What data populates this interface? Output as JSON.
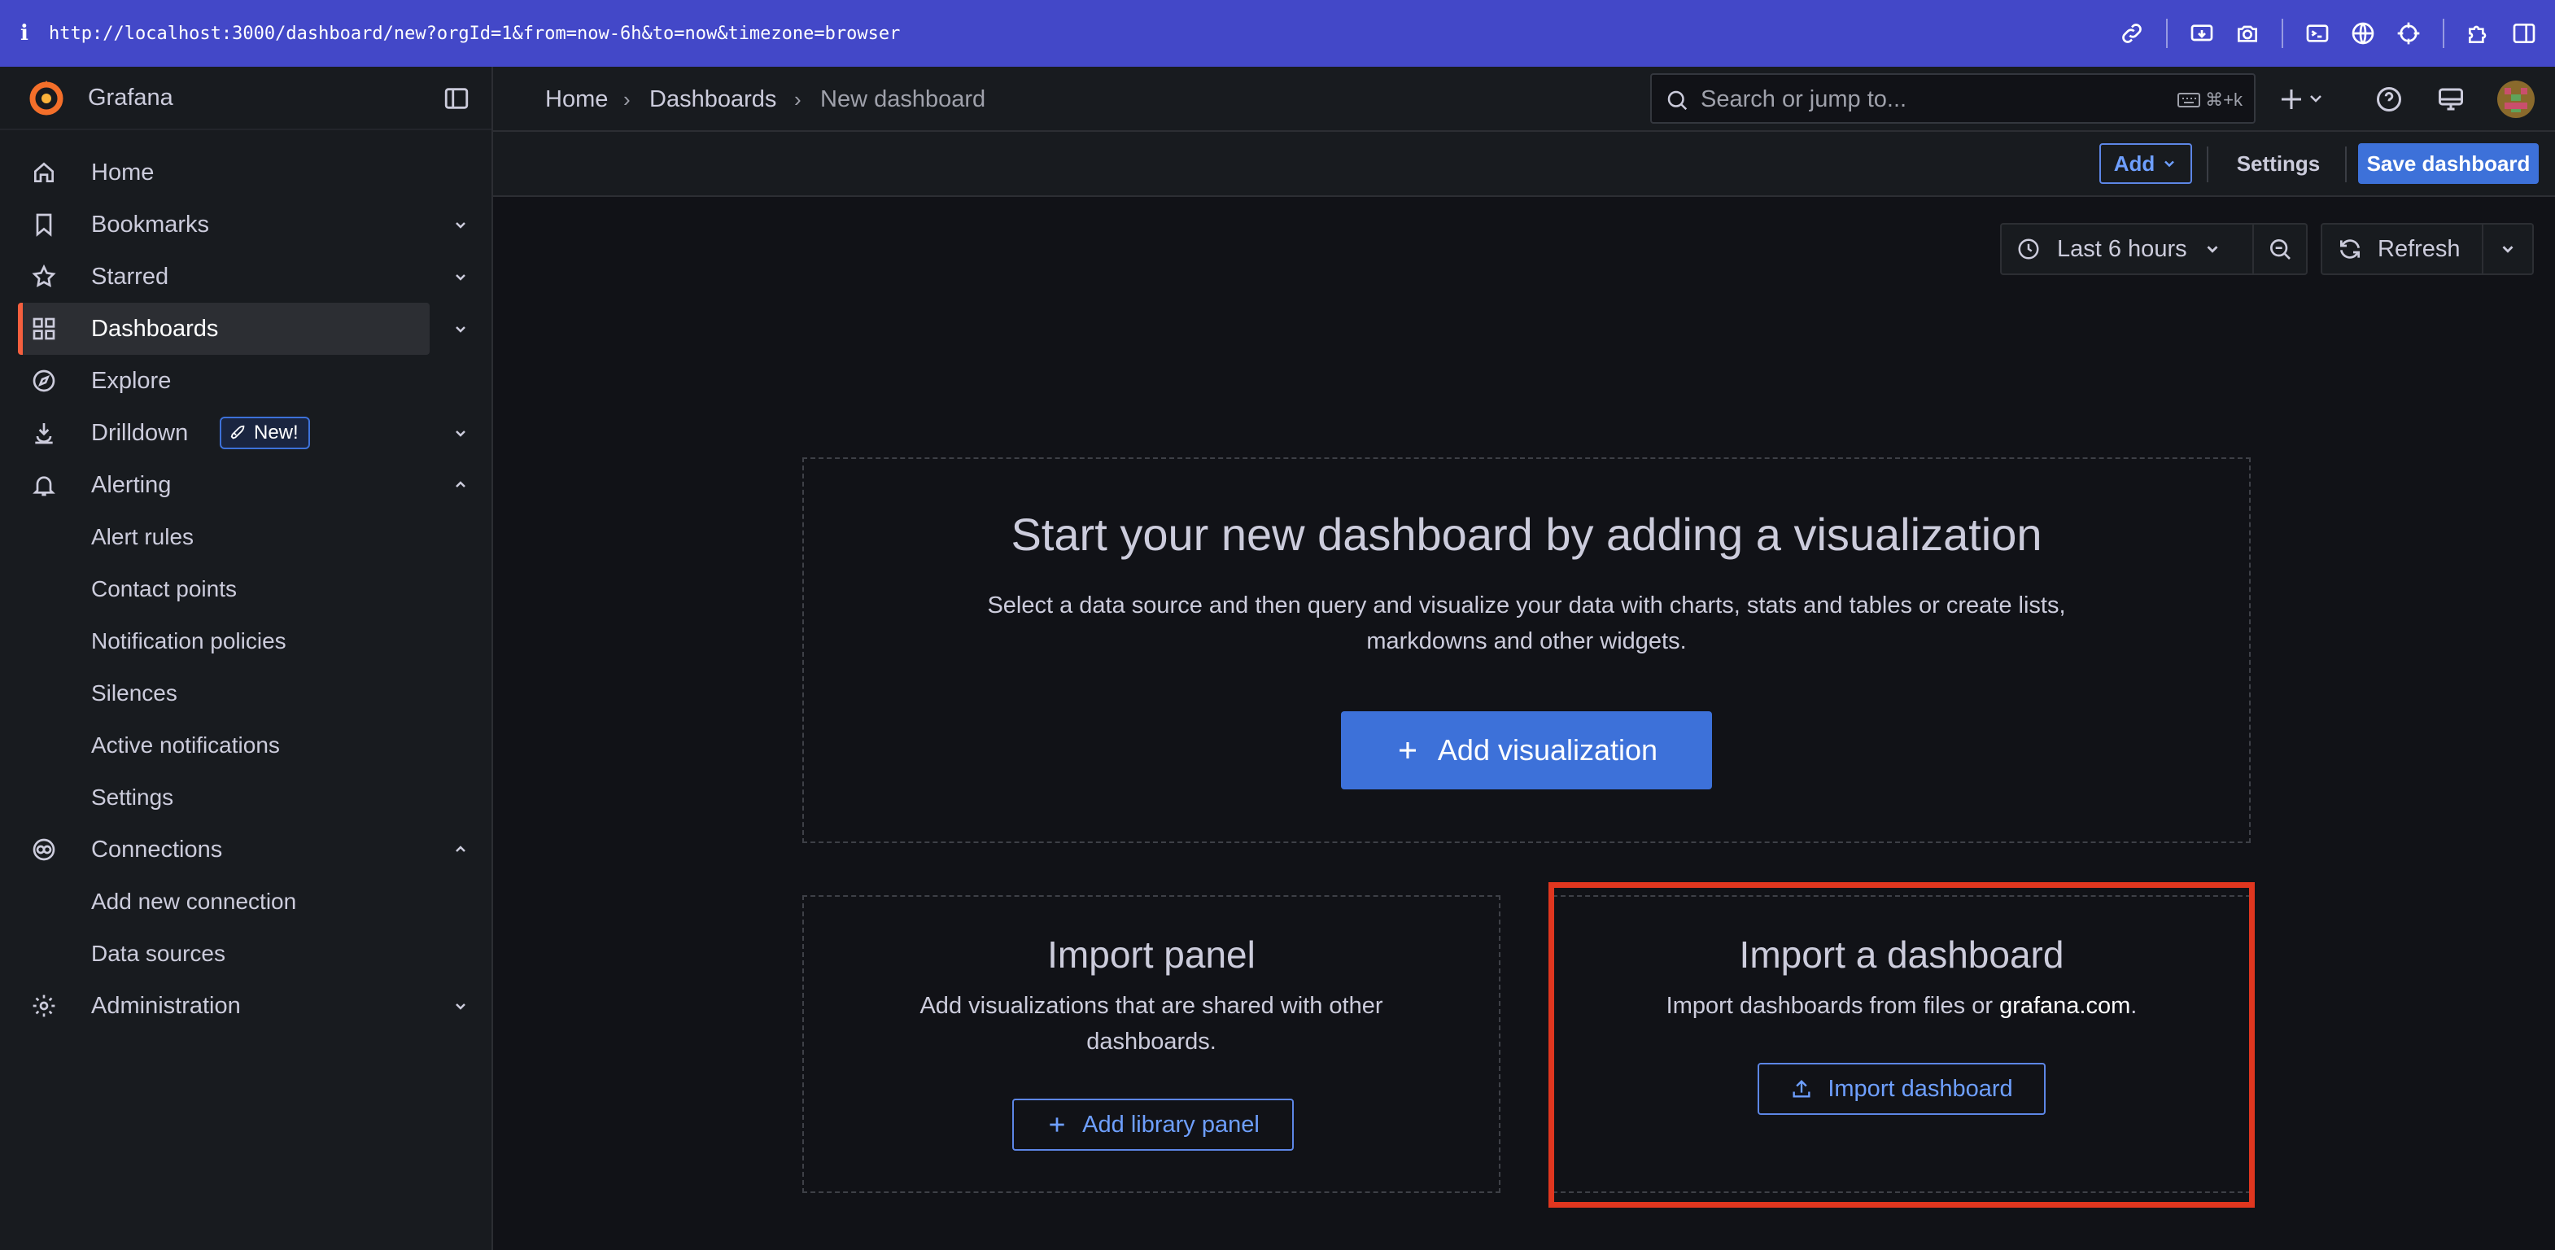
{
  "browser": {
    "info_glyph": "i",
    "url": "http://localhost:3000/dashboard/new?orgId=1&from=now-6h&to=now&timezone=browser"
  },
  "app": {
    "name": "Grafana"
  },
  "nav": {
    "items": [
      {
        "label": "Home",
        "icon": "home-icon"
      },
      {
        "label": "Bookmarks",
        "icon": "bookmark-icon"
      },
      {
        "label": "Starred",
        "icon": "star-icon"
      },
      {
        "label": "Dashboards",
        "icon": "apps-icon",
        "active": true
      },
      {
        "label": "Explore",
        "icon": "compass-icon"
      },
      {
        "label": "Drilldown",
        "icon": "drilldown-icon",
        "badge": "New!"
      },
      {
        "label": "Alerting",
        "icon": "bell-icon"
      },
      {
        "label": "Alert rules"
      },
      {
        "label": "Contact points"
      },
      {
        "label": "Notification policies"
      },
      {
        "label": "Silences"
      },
      {
        "label": "Active notifications"
      },
      {
        "label": "Settings"
      },
      {
        "label": "Connections",
        "icon": "connections-icon"
      },
      {
        "label": "Add new connection"
      },
      {
        "label": "Data sources"
      },
      {
        "label": "Administration",
        "icon": "cog-icon"
      }
    ]
  },
  "breadcrumb": {
    "home": "Home",
    "dashboards": "Dashboards",
    "current": "New dashboard"
  },
  "search": {
    "placeholder": "Search or jump to...",
    "shortcut": "⌘+k"
  },
  "toolbar": {
    "add_label": "Add",
    "settings_label": "Settings",
    "save_label": "Save dashboard"
  },
  "time": {
    "range_label": "Last 6 hours",
    "refresh_label": "Refresh"
  },
  "empty_state": {
    "title": "Start your new dashboard by adding a visualization",
    "desc_line1": "Select a data source and then query and visualize your data with charts, stats and tables or create lists,",
    "desc_line2": "markdowns and other widgets.",
    "add_viz_label": "Add visualization"
  },
  "import_panel": {
    "title": "Import panel",
    "desc_line1": "Add visualizations that are shared with other",
    "desc_line2": "dashboards.",
    "button_label": "Add library panel"
  },
  "import_dashboard": {
    "title": "Import a dashboard",
    "desc_prefix": "Import dashboards from files or ",
    "desc_link": "grafana.com",
    "desc_suffix": ".",
    "button_label": "Import dashboard"
  },
  "colors": {
    "accent": "#3d71d9",
    "active_bar": "#f55f3e",
    "highlight": "#e0361f",
    "browser_bar": "#4348c8"
  }
}
